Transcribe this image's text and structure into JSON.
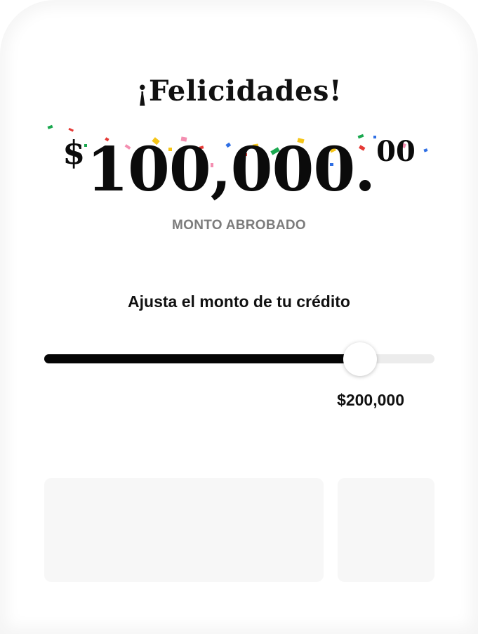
{
  "header": {
    "title": "¡Felicidades!"
  },
  "approved": {
    "currency_symbol": "$",
    "amount": "100,000.",
    "cents": "00",
    "label": "MONTO ABROBADO"
  },
  "adjust": {
    "title": "Ajusta el monto de tu crédito",
    "slider_fraction": 0.81,
    "max_label": "$200,000"
  },
  "colors": {
    "confetti": [
      "#1aa84f",
      "#e53935",
      "#f5c518",
      "#2f6fe4",
      "#f48fb1"
    ]
  }
}
